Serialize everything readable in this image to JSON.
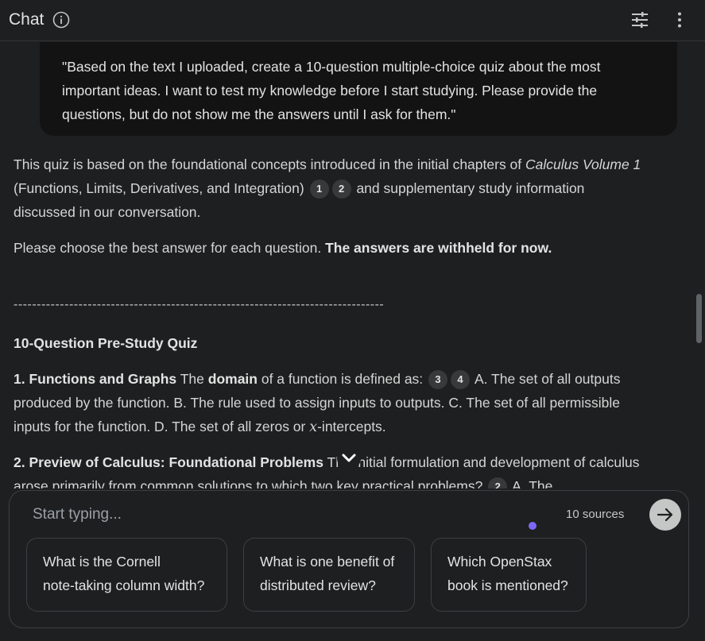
{
  "header": {
    "title": "Chat"
  },
  "user_message": {
    "text": "\"Based on the text I uploaded, create a 10-question multiple-choice quiz about the most important ideas. I want to test my knowledge before I start studying. Please provide the questions, but do not show me the answers until I ask for them.\""
  },
  "response": {
    "intro_part1": "This quiz is based on the foundational concepts introduced in the initial chapters of ",
    "intro_book": "Calculus Volume 1",
    "intro_part2": " (Functions, Limits, Derivatives, and Integration) ",
    "intro_part3": " and supplementary study information discussed in our conversation.",
    "cite_a": "1",
    "cite_b": "2",
    "instruction_plain": "Please choose the best answer for each question. ",
    "instruction_bold": "The answers are withheld for now.",
    "divider": "--------------------------------------------------------------------------------",
    "quiz_title": "10-Question Pre-Study Quiz",
    "q1_heading": "1. Functions and Graphs",
    "q1_part1": " The ",
    "q1_bold": "domain",
    "q1_part2": " of a function is defined as: ",
    "q1_cite_a": "3",
    "q1_cite_b": "4",
    "q1_part3": " A. The set of all outputs produced by the function. B. The rule used to assign inputs to outputs. C. The set of all permissible inputs for the function. D. The set of all zeros or ",
    "q1_var": "x",
    "q1_part4": "-intercepts.",
    "q2_heading": "2. Preview of Calculus: Foundational Problems",
    "q2_part1": " The initial formulation and development of calculus arose primarily from common solutions to which two key practical problems? ",
    "q2_cite": "2",
    "q2_part2": " A. The"
  },
  "composer": {
    "placeholder": "Start typing...",
    "sources": "10 sources"
  },
  "suggestions": [
    {
      "line1": "What is the Cornell",
      "line2": "note-taking column width?"
    },
    {
      "line1": "What is one benefit of",
      "line2": "distributed review?"
    },
    {
      "line1": "Which OpenStax",
      "line2": "book is mentioned?"
    }
  ],
  "colors": {
    "background": "#1e1f20",
    "bubble": "#131314",
    "accent_dot": "#7c68f5"
  },
  "icons": [
    "info-icon",
    "tune-icon",
    "more-vert-icon",
    "chevron-down-icon",
    "arrow-right-icon"
  ]
}
